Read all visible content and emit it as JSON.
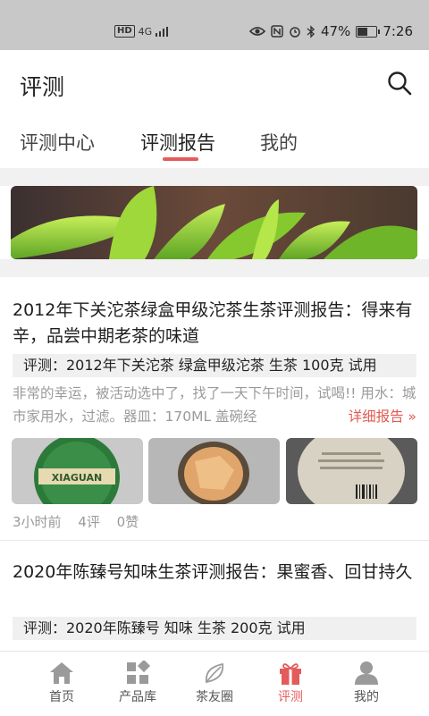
{
  "status_bar": {
    "network": "4G",
    "battery": "47%",
    "time": "7:26",
    "battery_level": 0.47
  },
  "header": {
    "title": "评测"
  },
  "tabs": [
    {
      "label": "评测中心"
    },
    {
      "label": "评测报告"
    },
    {
      "label": "我的"
    }
  ],
  "posts": [
    {
      "title": "2012年下关沱茶绿盒甲级沱茶生茶评测报告：得来有辛，品尝中期老茶的味道",
      "tag": "评测：2012年下关沱茶 绿盒甲级沱茶 生茶 100克 试用",
      "excerpt": "非常的幸运，被活动选中了，找了一天下午时间，试喝!! 用水：城市家用水，过滤。器皿：170ML 盖碗经",
      "more": "详细报告 »",
      "time": "3小时前",
      "comments": "4评",
      "likes": "0赞",
      "thumb_text": "XIAGUAN"
    },
    {
      "title": "2020年陈臻号知味生茶评测报告：果蜜香、回甘持久",
      "tag": "评测：2020年陈臻号 知味 生茶 200克 试用"
    }
  ],
  "nav": [
    {
      "label": "首页",
      "icon": "home-icon"
    },
    {
      "label": "产品库",
      "icon": "grid-icon"
    },
    {
      "label": "茶友圈",
      "icon": "leaf-icon"
    },
    {
      "label": "评测",
      "icon": "gift-icon"
    },
    {
      "label": "我的",
      "icon": "user-icon"
    }
  ],
  "colors": {
    "accent": "#e45b5b",
    "link": "#e05a50"
  }
}
